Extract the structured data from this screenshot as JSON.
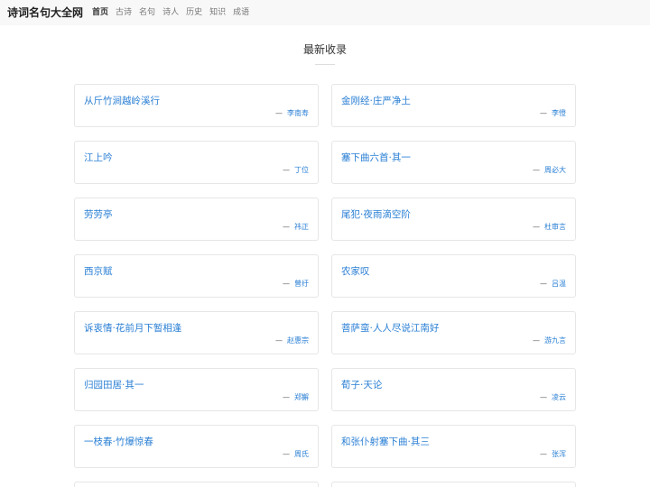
{
  "site": {
    "brand": "诗词名句大全网"
  },
  "nav": {
    "items": [
      {
        "label": "首页",
        "active": true
      },
      {
        "label": "古诗",
        "active": false
      },
      {
        "label": "名句",
        "active": false
      },
      {
        "label": "诗人",
        "active": false
      },
      {
        "label": "历史",
        "active": false
      },
      {
        "label": "知识",
        "active": false
      },
      {
        "label": "成语",
        "active": false
      }
    ]
  },
  "section": {
    "title": "最新收录"
  },
  "poems": [
    {
      "title": "从斤竹涧越岭溪行",
      "dash": "—",
      "author": "李南寿"
    },
    {
      "title": "金刚经·庄严净土",
      "dash": "—",
      "author": "李憕"
    },
    {
      "title": "江上吟",
      "dash": "—",
      "author": "丁位"
    },
    {
      "title": "塞下曲六首·其一",
      "dash": "—",
      "author": "周必大"
    },
    {
      "title": "劳劳亭",
      "dash": "—",
      "author": "祎正"
    },
    {
      "title": "尾犯·夜雨滴空阶",
      "dash": "—",
      "author": "杜审言"
    },
    {
      "title": "西京赋",
      "dash": "—",
      "author": "曾纡"
    },
    {
      "title": "农家叹",
      "dash": "—",
      "author": "吕温"
    },
    {
      "title": "诉衷情·花前月下暂相逢",
      "dash": "—",
      "author": "赵惠宗"
    },
    {
      "title": "菩萨蛮·人人尽说江南好",
      "dash": "—",
      "author": "游九言"
    },
    {
      "title": "归园田居·其一",
      "dash": "—",
      "author": "郑獬"
    },
    {
      "title": "荀子·天论",
      "dash": "—",
      "author": "凌云"
    },
    {
      "title": "一枝春·竹爆惊春",
      "dash": "—",
      "author": "周氏"
    },
    {
      "title": "和张仆射塞下曲·其三",
      "dash": "—",
      "author": "张浑"
    }
  ]
}
